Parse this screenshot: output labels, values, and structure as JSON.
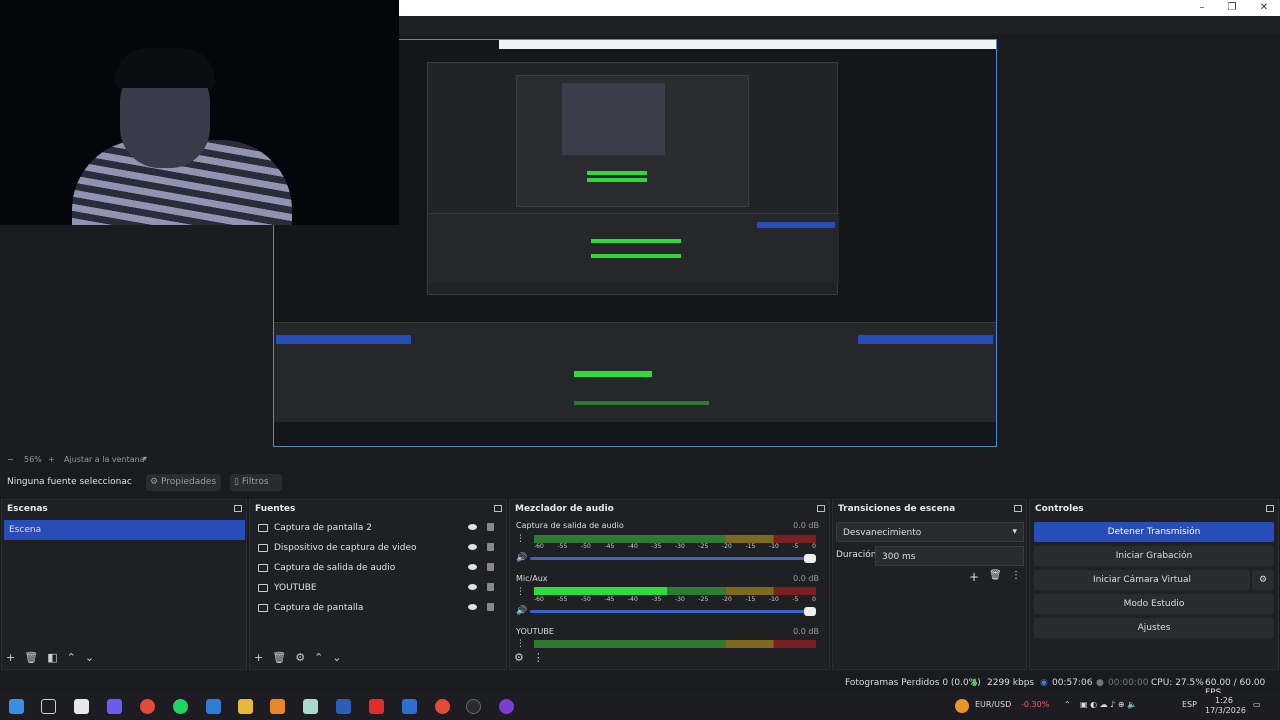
{
  "window": {
    "minimize": "–",
    "maximize": "❐",
    "close": "✕"
  },
  "zoom": {
    "minus": "−",
    "percent": "56%",
    "plus": "+",
    "fit_label": "Ajustar a la ventana"
  },
  "source_bar": {
    "status": "Ninguna fuente seleccionac",
    "properties": "Propiedades",
    "filters": "Filtros"
  },
  "scenes": {
    "title": "Escenas",
    "items": [
      "Escena"
    ]
  },
  "sources": {
    "title": "Fuentes",
    "items": [
      {
        "label": "Captura de pantalla 2",
        "icon": "monitor-icon"
      },
      {
        "label": "Dispositivo de captura de video",
        "icon": "camera-icon"
      },
      {
        "label": "Captura de salida de audio",
        "icon": "speaker-icon"
      },
      {
        "label": "YOUTUBE",
        "icon": "browser-icon"
      },
      {
        "label": "Captura de pantalla",
        "icon": "monitor-icon"
      }
    ]
  },
  "mixer": {
    "title": "Mezclador de audio",
    "ticks": [
      "-60",
      "-55",
      "-50",
      "-45",
      "-40",
      "-35",
      "-30",
      "-25",
      "-20",
      "-15",
      "-10",
      "-5",
      "0"
    ],
    "channels": [
      {
        "name": "Captura de salida de audio",
        "db": "0.0 dB",
        "level": 0.0
      },
      {
        "name": "Mic/Aux",
        "db": "0.0 dB",
        "level": 0.47
      },
      {
        "name": "YOUTUBE",
        "db": "0.0 dB",
        "level": 0.0
      }
    ]
  },
  "transitions": {
    "title": "Transiciones de escena",
    "selected": "Desvanecimiento",
    "duration_label": "Duración",
    "duration_value": "300 ms"
  },
  "controls": {
    "title": "Controles",
    "buttons": [
      "Detener Transmisión",
      "Iniciar Grabación",
      "Iniciar Cámara Virtual",
      "Modo Estudio",
      "Ajustes"
    ]
  },
  "status": {
    "dropped": "Fotogramas Perdidos 0 (0.0%)",
    "bitrate": "2299 kbps",
    "live_time": "00:57:06",
    "rec_time": "00:00:00",
    "cpu": "CPU: 27.5%",
    "fps": "60.00 / 60.00 FPS"
  },
  "tray": {
    "currency": "EUR/USD",
    "change": "-0.30%",
    "lang": "ESP",
    "time": "1:26",
    "date": "17/3/2026"
  },
  "colors": {
    "accent": "#284cb8",
    "meter_green": "#2edb3a",
    "negative": "#ff5a5a"
  }
}
